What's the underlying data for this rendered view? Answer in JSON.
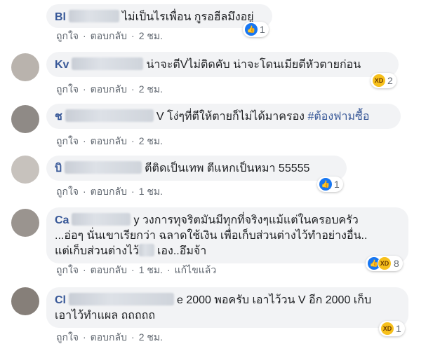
{
  "actions": {
    "like": "ถูกใจ",
    "reply": "ตอบกลับ",
    "edited": "แก้ไขแล้ว",
    "sep": "·"
  },
  "comments": [
    {
      "name": "Bl",
      "text": "ไม่เป็นไรเพื่อน กูรอฮีลมึงอยู่",
      "time": "2 ชม.",
      "reaction_count": "1",
      "reactions": [
        "like-icon"
      ]
    },
    {
      "name": "Kv",
      "text": "น่าจะตีVไม่ติดคับ น่าจะโดนเมียตีหัวตายก่อน",
      "time": "2 ชม.",
      "reaction_count": "2",
      "reactions": [
        "haha-icon"
      ]
    },
    {
      "name": "ช",
      "text": "V โง่ๆที่ตีให้ตายก็ไม่ได้มาครอง",
      "hashtag": "#ต้องฟามซื้อ",
      "time": "2 ชม."
    },
    {
      "name": "บิ",
      "text": "ตีติดเป็นเทพ ตีแหกเป็นหมา 55555",
      "time": "1 ชม.",
      "reaction_count": "1",
      "reactions": [
        "like-icon"
      ]
    },
    {
      "name": "Ca",
      "text_line1": "y วงการทุจริตมันมีทุกที่จริงๆแม้แต่ในครอบครัว",
      "text_line2": "...อ่อๆ นั่นเขาเรียกว่า ฉลาดใช้เงิน เพื่อเก็บส่วนต่างไว้ทำอย่างอื่น..",
      "text_line3a": "แต่เก็บส่วนต่างไว้",
      "text_line3b": "เอง..อึมจ้า",
      "time": "1 ชม.",
      "reaction_count": "8",
      "reactions": [
        "like-icon",
        "haha-icon"
      ]
    },
    {
      "name": "Cl",
      "text_line1": "e 2000 พอครับ เอาไว้วน V อีก 2000 เก็บ",
      "text_line2": "เอาไว้ทำแผล ถถถถถ",
      "time": "2 ชม.",
      "reaction_count": "1",
      "reactions": [
        "haha-icon"
      ]
    }
  ]
}
